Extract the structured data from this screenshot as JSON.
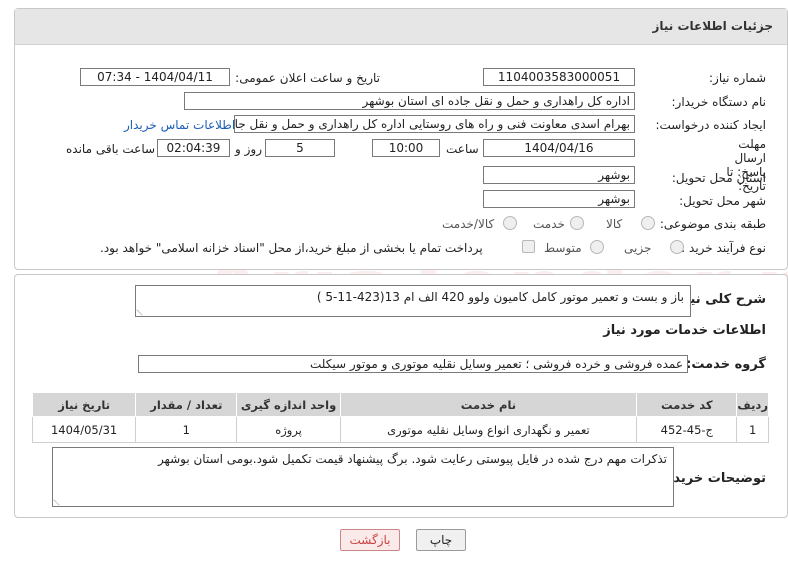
{
  "header": {
    "title": "جزئیات اطلاعات نیاز"
  },
  "fields": {
    "need_number_label": "شماره نیاز:",
    "need_number": "1104003583000051",
    "announce_label": "تاریخ و ساعت اعلان عمومی:",
    "announce_value": "1404/04/11 - 07:34",
    "buyer_org_label": "نام دستگاه خریدار:",
    "buyer_org": "اداره کل راهداری و حمل و نقل جاده ای استان بوشهر",
    "creator_label": "ایجاد کننده درخواست:",
    "creator": "بهرام اسدی معاونت فنی و راه های روستایی اداره کل راهداری و حمل و نقل جا",
    "contact_link": "اطلاعات تماس خریدار",
    "deadline_label": "مهلت ارسال پاسخ: تا تاریخ:",
    "deadline_date": "1404/04/16",
    "hour_label": "ساعت",
    "deadline_time": "10:00",
    "days_value": "5",
    "days_label": "روز و",
    "remaining_time": "02:04:39",
    "remaining_label": "ساعت باقی مانده",
    "province_label": "استان محل تحویل:",
    "province": "بوشهر",
    "city_label": "شهر محل تحویل:",
    "city": "بوشهر",
    "category_label": "طبقه بندی موضوعی:",
    "category_options": [
      "کالا",
      "خدمت",
      "کالا/خدمت"
    ],
    "process_label": "نوع فرآیند خرید :",
    "process_options": [
      "جزیی",
      "متوسط"
    ],
    "payment_note": "پرداخت تمام یا بخشی از مبلغ خرید،از محل \"اسناد خزانه اسلامی\" خواهد بود."
  },
  "summary": {
    "label": "شرح کلی نیاز:",
    "value": "باز و بست و تعمیر موتور کامل کامیون ولوو 420 الف ام 13(423-11-5 )"
  },
  "services": {
    "section_title": "اطلاعات خدمات مورد نیاز",
    "group_label": "گروه خدمت:",
    "group_value": "عمده فروشی و خرده فروشی ؛ تعمیر وسایل نقلیه موتوری و موتور سیکلت",
    "columns": [
      "ردیف",
      "کد خدمت",
      "نام خدمت",
      "واحد اندازه گیری",
      "تعداد / مقدار",
      "تاریخ نیاز"
    ],
    "rows": [
      {
        "row": "1",
        "code": "ج-45-452",
        "name": "تعمیر و نگهداری انواع وسایل نقلیه موتوری",
        "unit": "پروژه",
        "qty": "1",
        "date": "1404/05/31"
      }
    ]
  },
  "notes": {
    "label": "توضیحات خریدار:",
    "value": "تذکرات مهم درج شده در فایل پیوستی رعایت شود. برگ پیشنهاد قیمت تکمیل شود.بومی استان بوشهر"
  },
  "buttons": {
    "print": "چاپ",
    "back": "بازگشت"
  },
  "watermark": "AriaTender.neT"
}
